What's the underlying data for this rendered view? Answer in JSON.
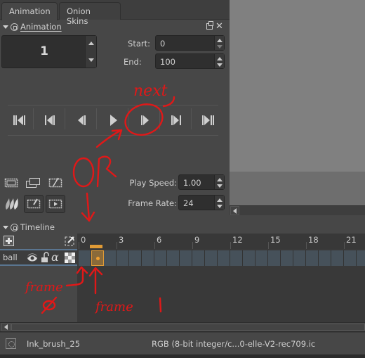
{
  "tabs": [
    {
      "label": "Animation",
      "accel": "A",
      "active": true
    },
    {
      "label": "Onion Skins",
      "accel": "O",
      "active": false
    }
  ],
  "animation_docker": {
    "title": "Animation",
    "current_frame": "1",
    "start_label": "Start:",
    "start_value": "0",
    "end_label": "End:",
    "end_value": "100",
    "transport_buttons": [
      {
        "name": "first-frame",
        "icon": "skip-to-start-icon"
      },
      {
        "name": "previous-keyframe",
        "icon": "previous-keyframe-icon"
      },
      {
        "name": "previous-frame",
        "icon": "previous-frame-icon"
      },
      {
        "name": "play",
        "icon": "play-icon"
      },
      {
        "name": "next-frame",
        "icon": "next-frame-icon"
      },
      {
        "name": "next-keyframe",
        "icon": "next-keyframe-icon"
      },
      {
        "name": "last-frame",
        "icon": "skip-to-end-icon"
      }
    ],
    "play_speed_label": "Play Speed:",
    "play_speed_value": "1.00",
    "frame_rate_label": "Frame Rate:",
    "frame_rate_value": "24",
    "tool_icons": [
      "add-blank-frame-icon",
      "copy-frame-icon",
      "remove-frame-icon",
      "onion-skin-icon",
      "draw-frame-icon",
      "play-frame-icon"
    ]
  },
  "timeline": {
    "title": "Timeline",
    "ruler_ticks": [
      "0",
      "3",
      "6",
      "9",
      "12",
      "15",
      "18",
      "21"
    ],
    "layers": [
      {
        "name": "ball",
        "icons": [
          "visibility-eye-icon",
          "lock-icon",
          "alpha-icon",
          "transparency-checker-icon"
        ]
      }
    ],
    "current_frame": 1,
    "keyframes": [
      1
    ]
  },
  "status_bar": {
    "brush_name": "Ink_brush_25",
    "color_profile": "RGB (8-bit integer/c...0-elle-V2-rec709.ic"
  },
  "annotations": {
    "next": "next",
    "or": "OR",
    "frame0": "frame",
    "frame0_num": "Ø",
    "frame1": "frame 1",
    "color": "#e01818"
  }
}
